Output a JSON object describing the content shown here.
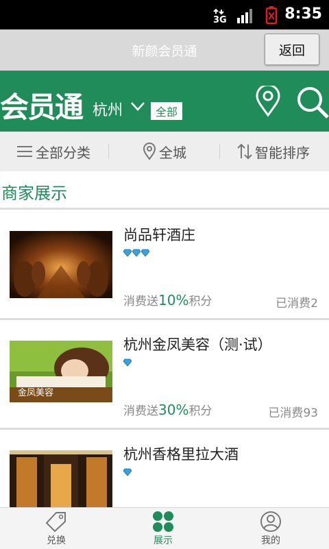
{
  "status_bar": {
    "network": "3G",
    "time": "8:35"
  },
  "header": {
    "title": "新颜会员通",
    "back_label": "返回"
  },
  "brand": {
    "logo_text": "会员通",
    "city": "杭州",
    "scope": "全部",
    "accent_color": "#1f8c5a"
  },
  "filters": {
    "category": "全部分类",
    "area": "全城",
    "sort": "智能排序"
  },
  "section": {
    "title": "商家展示"
  },
  "merchants": [
    {
      "name": "尚品轩酒庄",
      "gem_count": 3,
      "points_prefix": "消费送",
      "points_pct": "10%",
      "points_suffix": "积分",
      "spent": "已消费2"
    },
    {
      "name": "杭州金凤美容（测·试）",
      "gem_count": 1,
      "points_prefix": "消费送",
      "points_pct": "30%",
      "points_suffix": "积分",
      "spent": "已消费93",
      "thumb_caption": "金凤美容"
    },
    {
      "name": "杭州香格里拉大酒",
      "gem_count": 1
    }
  ],
  "tabs": [
    {
      "label": "兑换",
      "icon": "tag-icon"
    },
    {
      "label": "展示",
      "icon": "grid-icon"
    },
    {
      "label": "我的",
      "icon": "user-icon"
    }
  ]
}
